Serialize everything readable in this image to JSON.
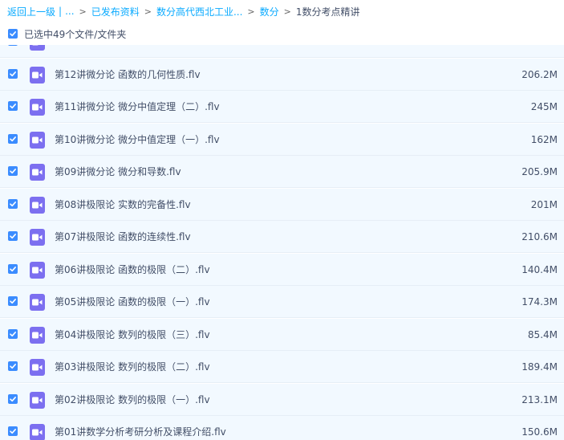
{
  "breadcrumb": {
    "back_label": "返回上一级",
    "back_sep": "|",
    "ellipsis": "...",
    "items": [
      "已发布资料",
      "数分高代西北工业...",
      "数分",
      "1数分考点精讲"
    ],
    "separator": ">"
  },
  "selection": {
    "label": "已选中49个文件/文件夹",
    "checked": true
  },
  "colors": {
    "link": "#09aaff",
    "checkbox": "#3b8cff",
    "row_bg": "#f2f9ff",
    "video_icon": "#7c6ff0"
  },
  "files": [
    {
      "name": "",
      "size": "",
      "icon": "video-file-icon",
      "checked": true
    },
    {
      "name": "第12讲微分论 函数的几何性质.flv",
      "size": "206.2M",
      "icon": "video-file-icon",
      "checked": true
    },
    {
      "name": "第11讲微分论 微分中值定理（二）.flv",
      "size": "245M",
      "icon": "video-file-icon",
      "checked": true
    },
    {
      "name": "第10讲微分论 微分中值定理（一）.flv",
      "size": "162M",
      "icon": "video-file-icon",
      "checked": true
    },
    {
      "name": "第09讲微分论 微分和导数.flv",
      "size": "205.9M",
      "icon": "video-file-icon",
      "checked": true
    },
    {
      "name": "第08讲极限论 实数的完备性.flv",
      "size": "201M",
      "icon": "video-file-icon",
      "checked": true
    },
    {
      "name": "第07讲极限论 函数的连续性.flv",
      "size": "210.6M",
      "icon": "video-file-icon",
      "checked": true
    },
    {
      "name": "第06讲极限论 函数的极限（二）.flv",
      "size": "140.4M",
      "icon": "video-file-icon",
      "checked": true
    },
    {
      "name": "第05讲极限论 函数的极限（一）.flv",
      "size": "174.3M",
      "icon": "video-file-icon",
      "checked": true
    },
    {
      "name": "第04讲极限论 数列的极限（三）.flv",
      "size": "85.4M",
      "icon": "video-file-icon",
      "checked": true
    },
    {
      "name": "第03讲极限论 数列的极限（二）.flv",
      "size": "189.4M",
      "icon": "video-file-icon",
      "checked": true
    },
    {
      "name": "第02讲极限论 数列的极限（一）.flv",
      "size": "213.1M",
      "icon": "video-file-icon",
      "checked": true
    },
    {
      "name": "第01讲数学分析考研分析及课程介绍.flv",
      "size": "150.6M",
      "icon": "video-file-icon",
      "checked": true
    }
  ]
}
